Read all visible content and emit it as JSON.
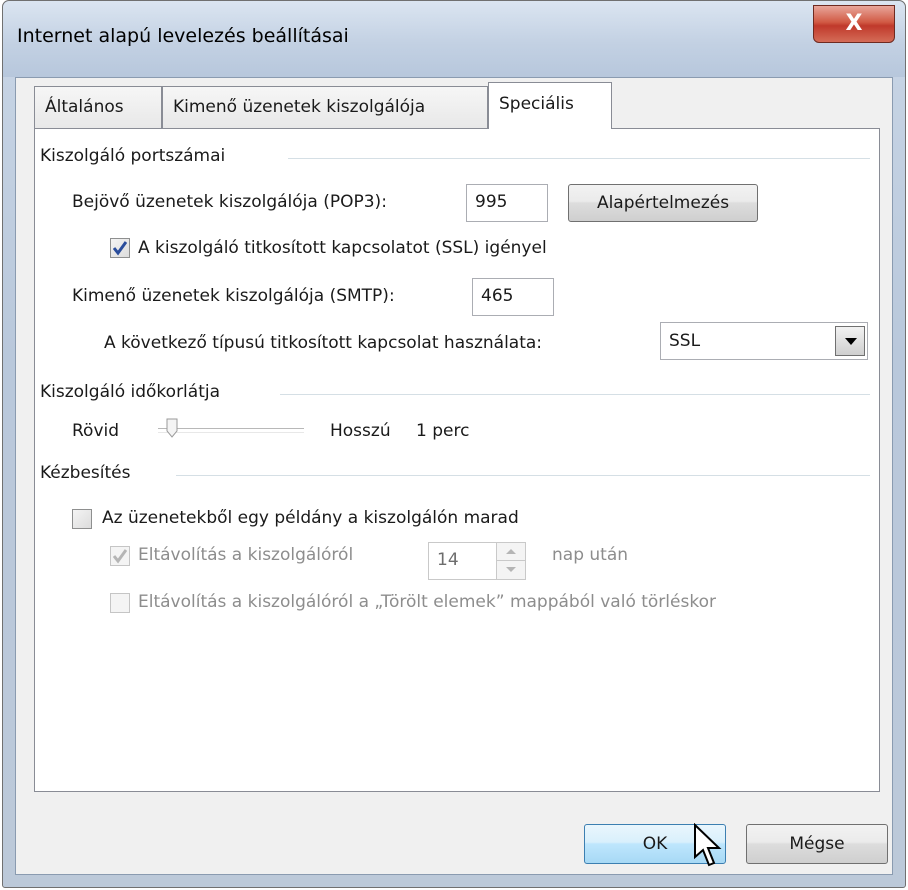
{
  "window": {
    "title": "Internet alapú levelezés beállításai",
    "close_label": "X"
  },
  "tabs": [
    {
      "label": "Általános"
    },
    {
      "label": "Kimenő üzenetek kiszolgálója"
    },
    {
      "label": "Speciális",
      "active": true
    }
  ],
  "ports": {
    "group_label": "Kiszolgáló portszámai",
    "pop3_label": "Bejövő üzenetek kiszolgálója (POP3):",
    "pop3_value": "995",
    "default_button": "Alapértelmezés",
    "ssl_check_label": "A kiszolgáló titkosított kapcsolatot (SSL) igényel",
    "ssl_checked": true,
    "smtp_label": "Kimenő üzenetek kiszolgálója (SMTP):",
    "smtp_value": "465",
    "encryption_label": "A következő típusú titkosított kapcsolat használata:",
    "encryption_value": "SSL"
  },
  "timeout": {
    "group_label": "Kiszolgáló időkorlátja",
    "short_label": "Rövid",
    "long_label": "Hosszú",
    "value_label": "1 perc",
    "level": 0.1
  },
  "delivery": {
    "group_label": "Kézbesítés",
    "leave_copy_label": "Az üzenetekből egy példány a kiszolgálón marad",
    "leave_copy_checked": false,
    "remove_after_label": "Eltávolítás a kiszolgálóról",
    "remove_after_checked": true,
    "days_value": "14",
    "days_suffix": "nap után",
    "remove_deleted_label": "Eltávolítás a kiszolgálóról a „Törölt elemek” mappából való törléskor",
    "remove_deleted_checked": false
  },
  "footer": {
    "ok_label": "OK",
    "cancel_label": "Mégse"
  },
  "icons": {
    "close": "close-icon",
    "checkmark": "checkmark-icon",
    "dropdown": "chevron-down-icon",
    "cursor": "mouse-pointer-icon"
  }
}
